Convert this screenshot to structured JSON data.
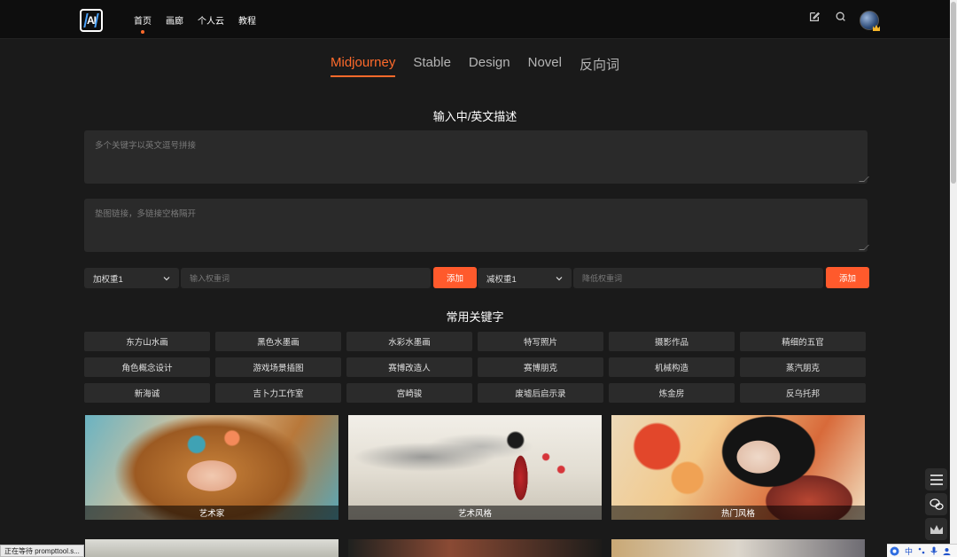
{
  "nav": {
    "logo_text": "AI",
    "items": [
      "首页",
      "画廊",
      "个人云",
      "教程"
    ]
  },
  "tabs": [
    "Midjourney",
    "Stable",
    "Design",
    "Novel",
    "反向词"
  ],
  "prompt_section": {
    "title": "输入中/英文描述",
    "keywords_placeholder": "多个关键字以英文逗号拼接",
    "links_placeholder": "垫图链接，多链接空格隔开"
  },
  "weights": {
    "increase_select": "加权重1",
    "increase_placeholder": "输入权重词",
    "increase_add": "添加",
    "decrease_select": "减权重1",
    "decrease_placeholder": "降低权重词",
    "decrease_add": "添加"
  },
  "keywords": {
    "title": "常用关键字",
    "items": [
      "东方山水画",
      "黑色水墨画",
      "水彩水墨画",
      "特写照片",
      "摄影作品",
      "精细的五官",
      "角色概念设计",
      "游戏场景插图",
      "赛博改造人",
      "赛博朋克",
      "机械构造",
      "蒸汽朋克",
      "新海诚",
      "吉卜力工作室",
      "宫崎骏",
      "废墟后启示录",
      "炼金房",
      "反乌托邦"
    ]
  },
  "cards": [
    "艺术家",
    "艺术风格",
    "热门风格"
  ],
  "status_text": "正在等待 prompttool.s...",
  "ime": {
    "lang": "中"
  },
  "colors": {
    "accent": "#ff5a2c",
    "background": "#1a1a1a",
    "panel": "#2a2a2a"
  },
  "icons": [
    "edit-icon",
    "search-icon",
    "menu-icon",
    "wechat-icon",
    "crown-icon"
  ]
}
